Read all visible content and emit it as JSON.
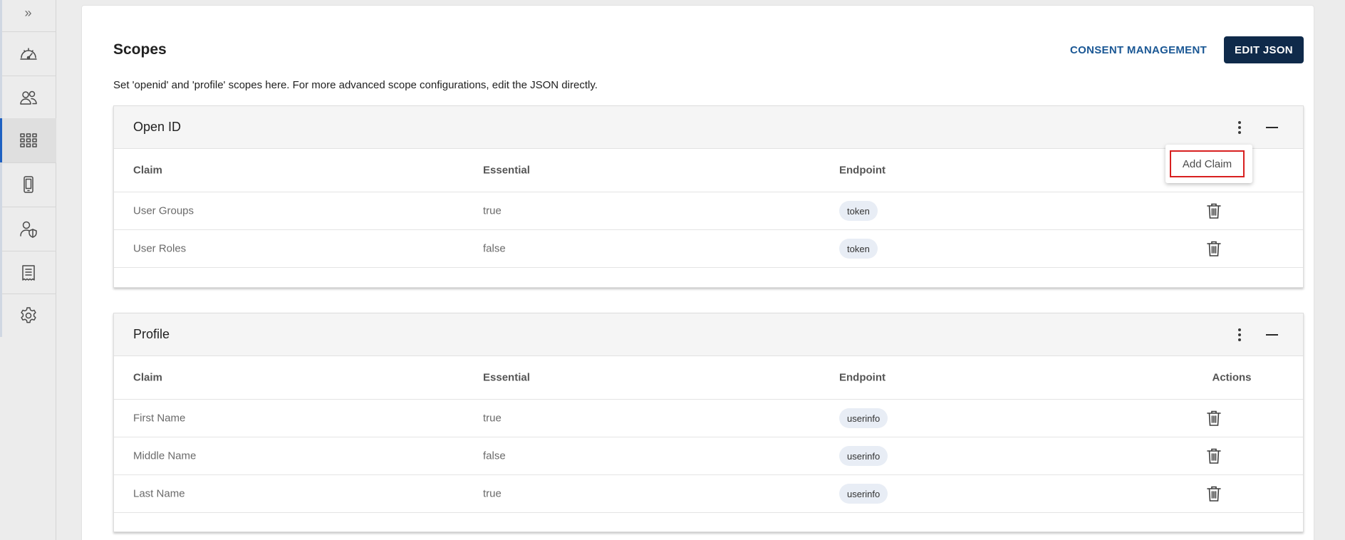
{
  "sidebar": {
    "expand_glyph": "»",
    "items": [
      {
        "icon": "dashboard-gauge-icon",
        "active": false
      },
      {
        "icon": "users-icon",
        "active": false
      },
      {
        "icon": "apps-grid-icon",
        "active": true
      },
      {
        "icon": "mobile-device-icon",
        "active": false
      },
      {
        "icon": "user-shield-icon",
        "active": false
      },
      {
        "icon": "receipt-log-icon",
        "active": false
      },
      {
        "icon": "gear-icon",
        "active": false
      }
    ]
  },
  "header": {
    "title": "Scopes",
    "consent_label": "CONSENT MANAGEMENT",
    "edit_json_label": "EDIT JSON",
    "description": "Set 'openid' and 'profile' scopes here. For more advanced scope configurations, edit the JSON directly."
  },
  "sections": [
    {
      "title": "Open ID",
      "columns": {
        "claim": "Claim",
        "essential": "Essential",
        "endpoint": "Endpoint",
        "actions": ""
      },
      "rows": [
        {
          "claim": "User Groups",
          "essential": "true",
          "endpoint": "token"
        },
        {
          "claim": "User Roles",
          "essential": "false",
          "endpoint": "token"
        }
      ]
    },
    {
      "title": "Profile",
      "columns": {
        "claim": "Claim",
        "essential": "Essential",
        "endpoint": "Endpoint",
        "actions": "Actions"
      },
      "rows": [
        {
          "claim": "First Name",
          "essential": "true",
          "endpoint": "userinfo"
        },
        {
          "claim": "Middle Name",
          "essential": "false",
          "endpoint": "userinfo"
        },
        {
          "claim": "Last Name",
          "essential": "true",
          "endpoint": "userinfo"
        }
      ]
    }
  ],
  "menu": {
    "add_claim_label": "Add Claim"
  },
  "colors": {
    "primary": "#0f2a4a",
    "link": "#1a5794",
    "active_nav": "#1f61c2",
    "highlight": "#d82020"
  }
}
